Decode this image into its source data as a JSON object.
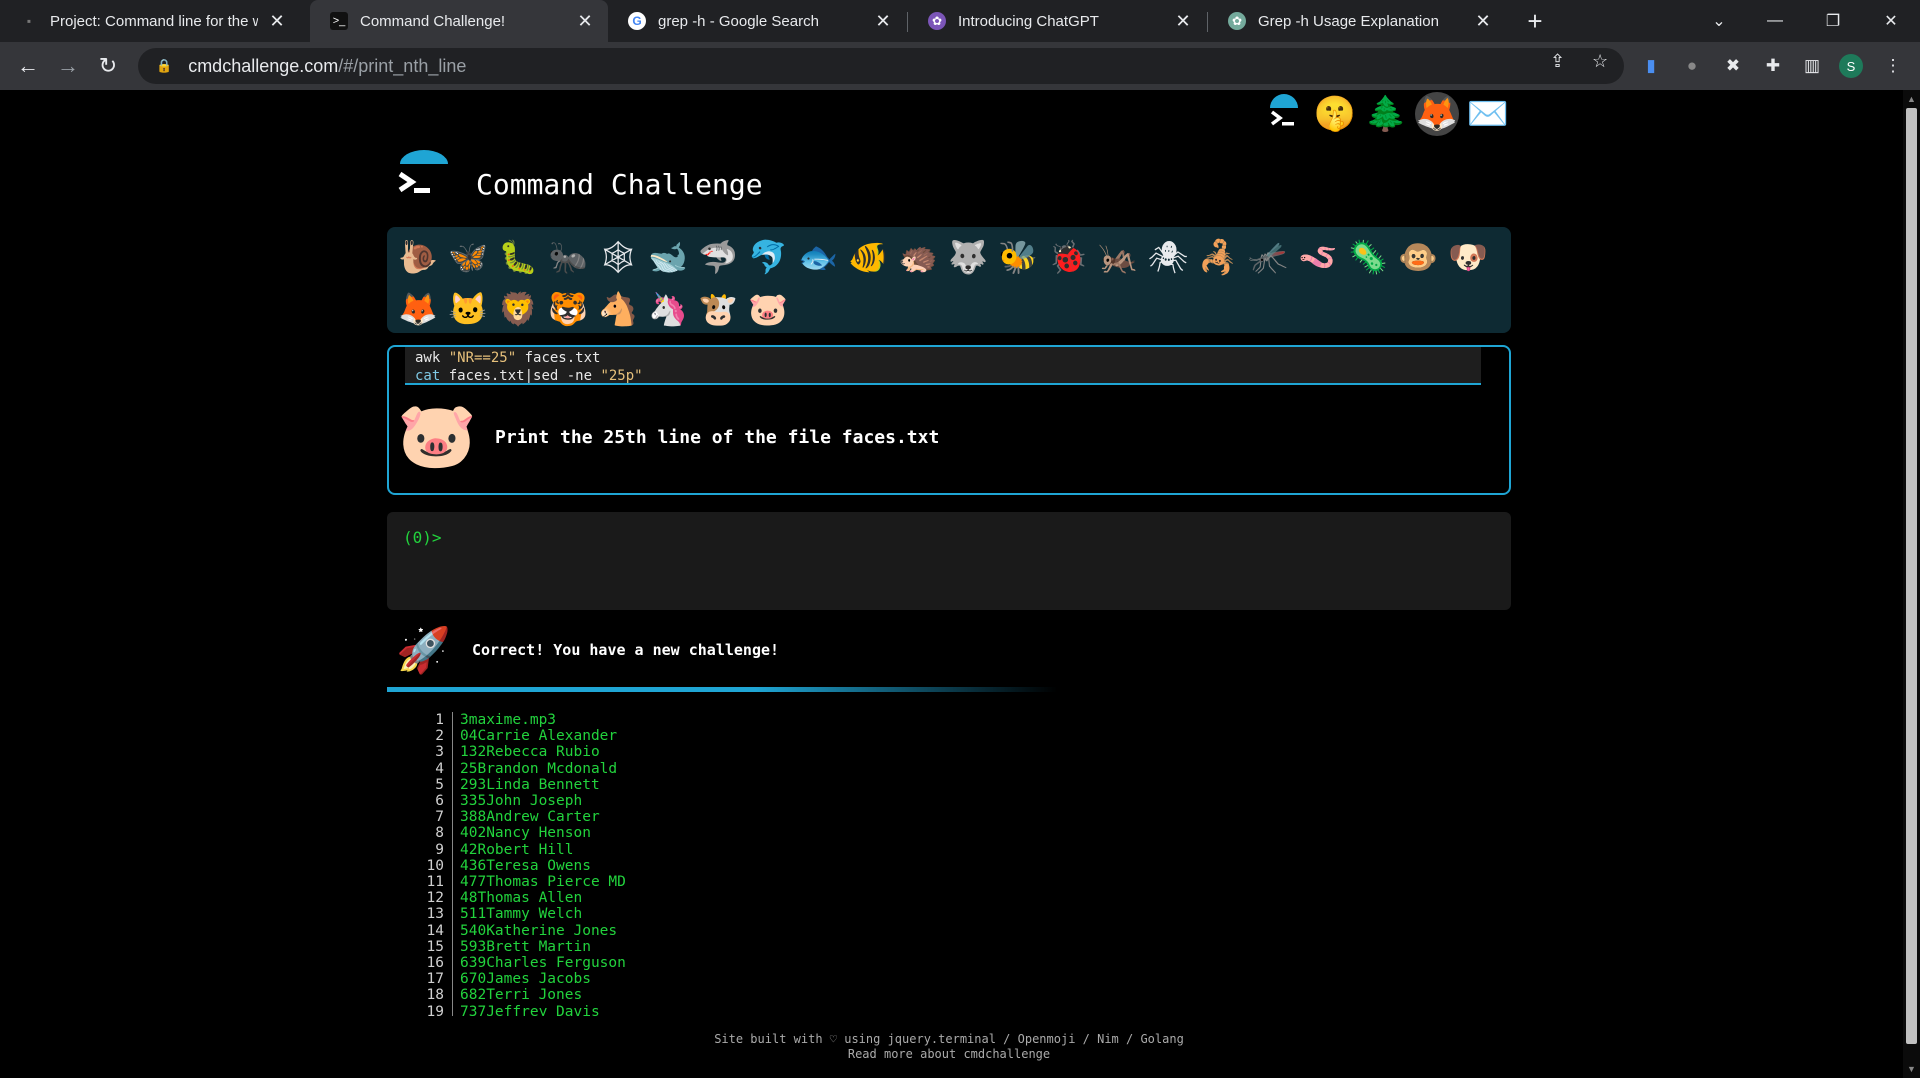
{
  "browser": {
    "tabs": [
      {
        "title": "Project: Command line for the wi",
        "favicon": "gitlab-icon",
        "active": false
      },
      {
        "title": "Command Challenge!",
        "favicon": "terminal-icon",
        "active": true
      },
      {
        "title": "grep -h - Google Search",
        "favicon": "google-icon",
        "active": false
      },
      {
        "title": "Introducing ChatGPT",
        "favicon": "openai-icon",
        "active": false
      },
      {
        "title": "Grep -h Usage Explanation",
        "favicon": "openai-icon",
        "active": false
      }
    ],
    "address": {
      "host": "cmdchallenge.com",
      "path": "/#/print_nth_line"
    },
    "profile_initial": "S"
  },
  "header": {
    "title": "Command Challenge"
  },
  "top_icons": [
    "terminal-logo-icon",
    "shushing-face-icon",
    "tree-icon",
    "gitlab-icon",
    "envelope-icon"
  ],
  "animals": [
    "🐌",
    "🦋",
    "🐛",
    "🐜",
    "🕸",
    "🐋",
    "🦈",
    "🐬",
    "🐟",
    "🐠",
    "🦔",
    "🐺",
    "🐝",
    "🐞",
    "🦗",
    "🕷",
    "🦂",
    "🦟",
    "🪱",
    "🦠",
    "🐵",
    "🐶",
    "🦊",
    "🐱",
    "🦁",
    "🐯",
    "🐴",
    "🦄",
    "🐮",
    "🐷"
  ],
  "challenge": {
    "hint_line1": {
      "cmd": "awk ",
      "str": "\"NR==25\"",
      "rest": " faces.txt"
    },
    "hint_line2": {
      "kw": "cat",
      "a": " faces.txt|sed -ne ",
      "str": "\"25p\""
    },
    "icon": "pig-face-icon",
    "text": "Print the 25th line of the file faces.txt"
  },
  "terminal": {
    "prompt": "(0)>"
  },
  "result": {
    "message": "Correct! You have a new challenge!"
  },
  "output": [
    {
      "n": "1",
      "text": "3maxime.mp3"
    },
    {
      "n": "2",
      "text": "04Carrie Alexander"
    },
    {
      "n": "3",
      "text": "132Rebecca Rubio"
    },
    {
      "n": "4",
      "text": "25Brandon Mcdonald"
    },
    {
      "n": "5",
      "text": "293Linda Bennett"
    },
    {
      "n": "6",
      "text": "335John Joseph"
    },
    {
      "n": "7",
      "text": "388Andrew Carter"
    },
    {
      "n": "8",
      "text": "402Nancy Henson"
    },
    {
      "n": "9",
      "text": "42Robert Hill"
    },
    {
      "n": "10",
      "text": "436Teresa Owens"
    },
    {
      "n": "11",
      "text": "477Thomas Pierce MD"
    },
    {
      "n": "12",
      "text": "48Thomas Allen"
    },
    {
      "n": "13",
      "text": "511Tammy Welch"
    },
    {
      "n": "14",
      "text": "540Katherine Jones"
    },
    {
      "n": "15",
      "text": "593Brett Martin"
    },
    {
      "n": "16",
      "text": "639Charles Ferguson"
    },
    {
      "n": "17",
      "text": "670James Jacobs"
    },
    {
      "n": "18",
      "text": "682Terri Jones"
    },
    {
      "n": "19",
      "text": "737Jeffrey Davis"
    }
  ],
  "footer": {
    "line1": "Site built with ♡ using jquery.terminal / Openmoji / Nim / Golang",
    "line2": "Read more about cmdchallenge"
  }
}
